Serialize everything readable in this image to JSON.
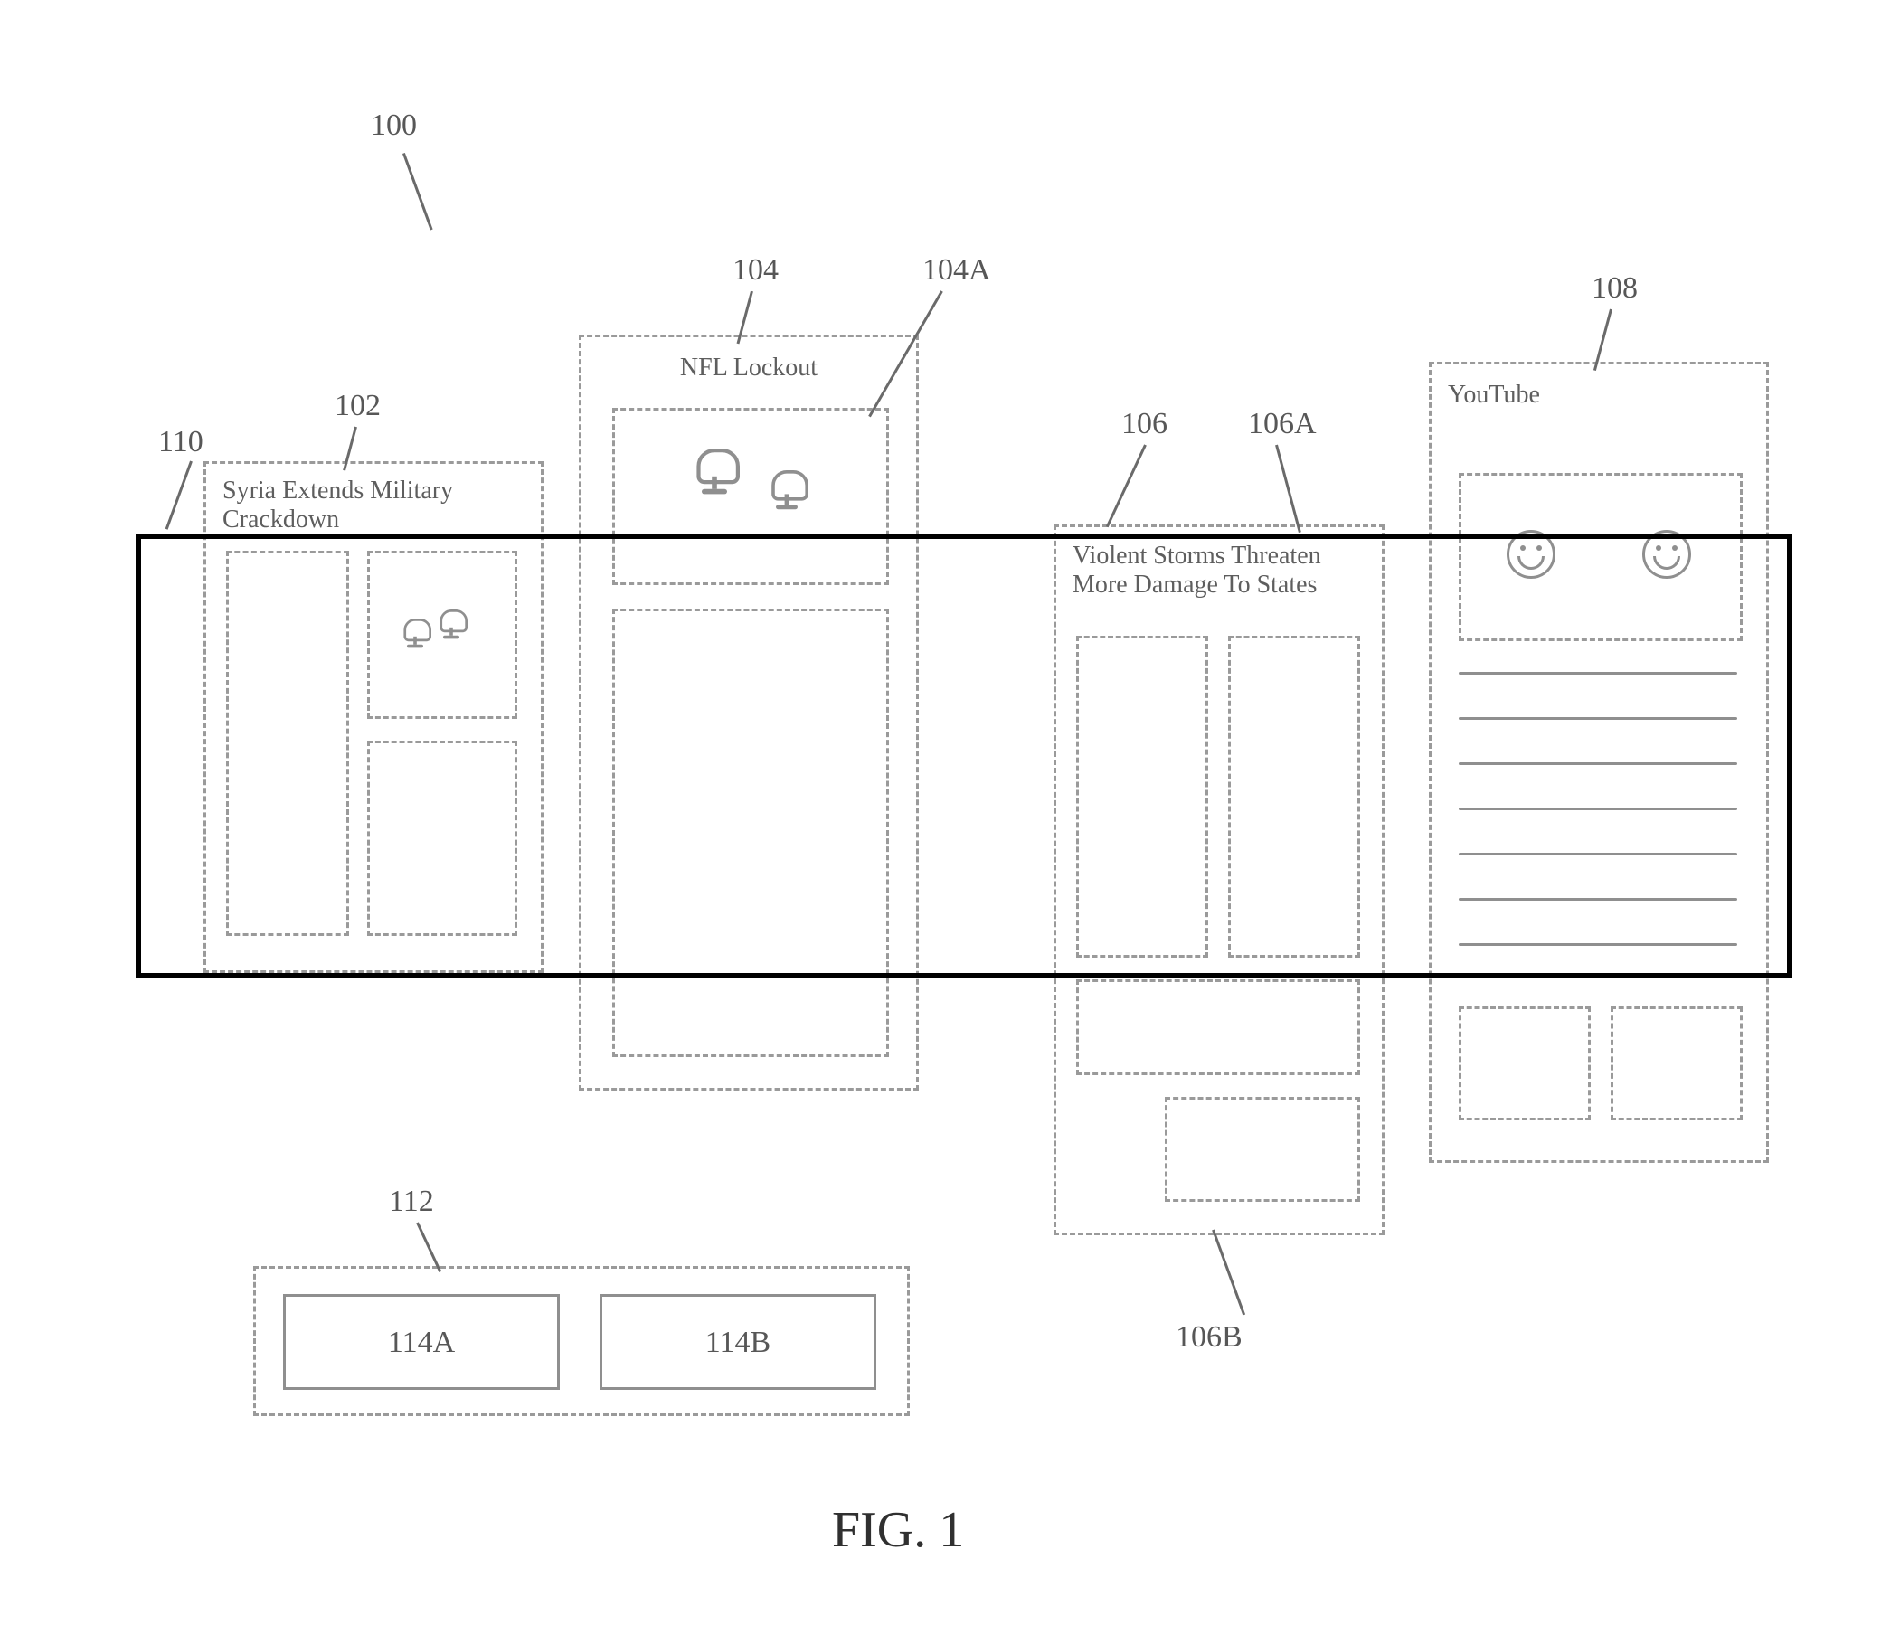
{
  "figure_label": "FIG. 1",
  "refs": {
    "r100": "100",
    "r102": "102",
    "r104": "104",
    "r104A": "104A",
    "r106": "106",
    "r106A": "106A",
    "r106B": "106B",
    "r108": "108",
    "r110": "110",
    "r112": "112",
    "r114A": "114A",
    "r114B": "114B"
  },
  "panels": {
    "p102": {
      "title": "Syria Extends Military Crackdown"
    },
    "p104": {
      "title": "NFL Lockout"
    },
    "p106": {
      "title": "Violent Storms Threaten More Damage To States"
    },
    "p108": {
      "title": "YouTube"
    }
  }
}
